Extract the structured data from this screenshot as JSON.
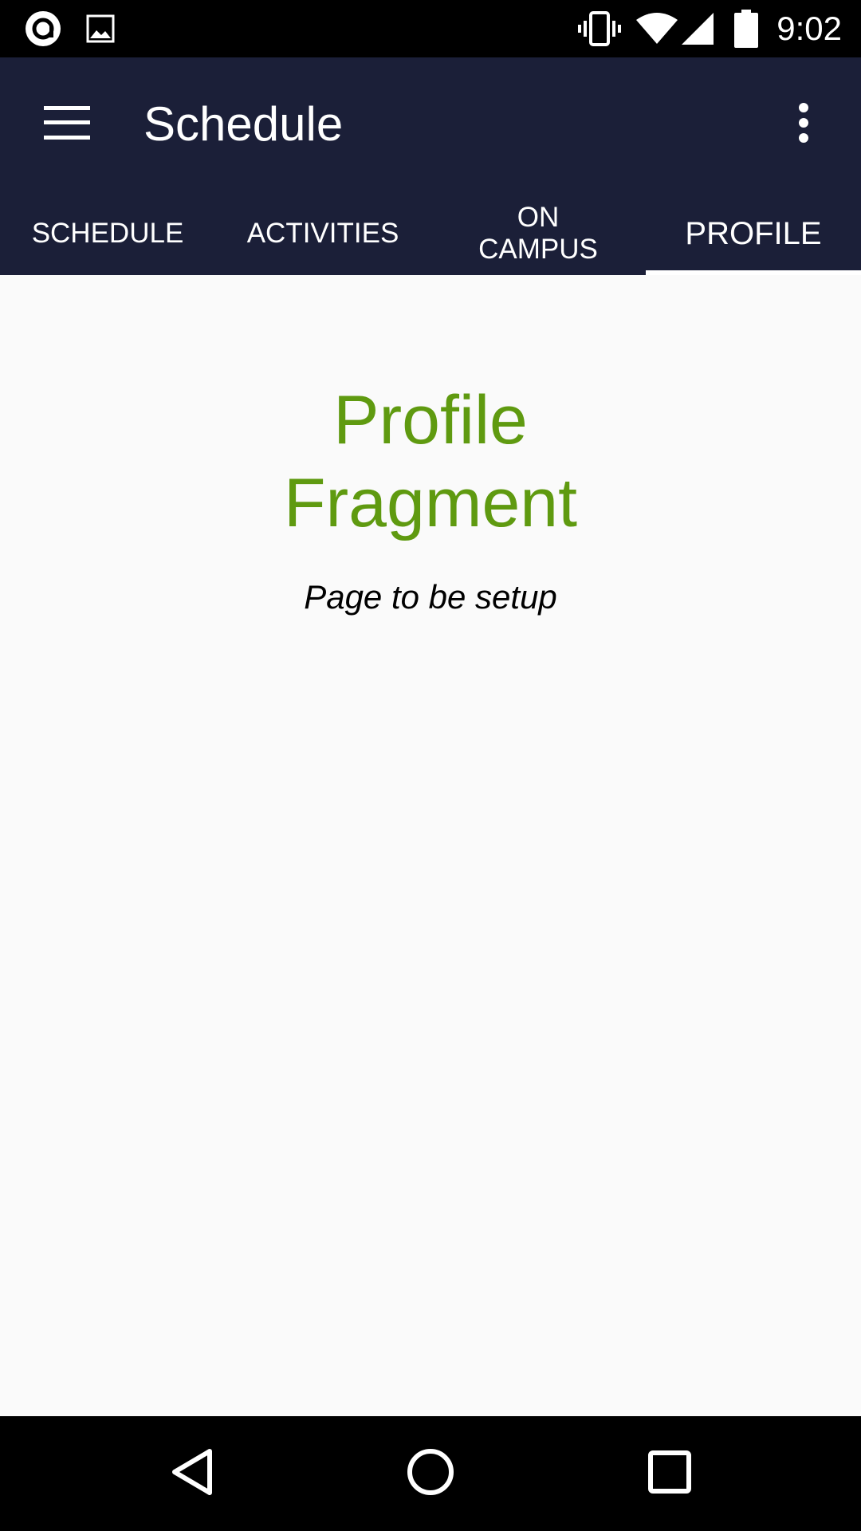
{
  "status_bar": {
    "time": "9:02",
    "icons": [
      "app-notification-icon",
      "image-notification-icon",
      "vibrate-icon",
      "wifi-icon",
      "cell-signal-icon",
      "battery-icon"
    ]
  },
  "toolbar": {
    "title": "Schedule",
    "menu_icon": "hamburger-menu-icon",
    "overflow_icon": "more-vert-icon"
  },
  "tabs": [
    {
      "label": "SCHEDULE",
      "active": false
    },
    {
      "label": "ACTIVITIES",
      "active": false
    },
    {
      "label": "ON CAMPUS",
      "active": false
    },
    {
      "label": "PROFILE",
      "active": true
    }
  ],
  "content": {
    "title": "Profile Fragment",
    "subtitle": "Page to be setup"
  },
  "nav_bar": {
    "icons": [
      "back-icon",
      "home-icon",
      "recents-icon"
    ]
  },
  "colors": {
    "app_bar": "#1b1f38",
    "accent_green": "#5f9a10",
    "background": "#fafafa"
  }
}
